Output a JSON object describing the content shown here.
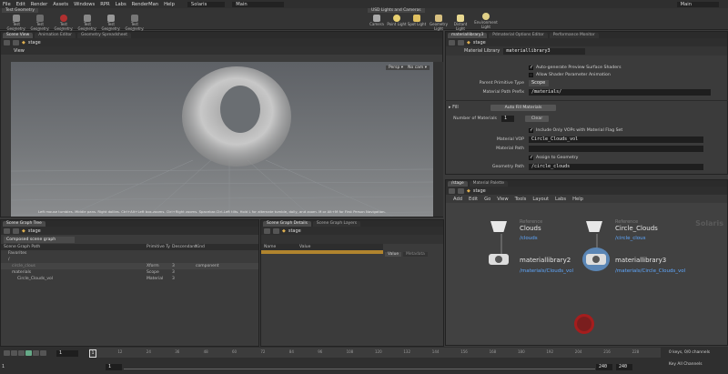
{
  "menu": {
    "items": [
      "File",
      "Edit",
      "Render",
      "Assets",
      "Windows",
      "RPR",
      "Labs",
      "RenderMan",
      "Help"
    ],
    "desktop": "Solaris",
    "context": "Main",
    "right_context": "Main"
  },
  "shelf": {
    "tabs_left": [
      "Test Geometry"
    ],
    "tabs_right": [
      "USD Lights and Cameras"
    ],
    "tools_left": [
      "Test Geometry: S...",
      "Test Geometry: T...",
      "Test Geometry: R...",
      "Test Geometry: S...",
      "Test Geometry: T...",
      "Test Geometry: T..."
    ],
    "tools_right": [
      "Camera",
      "Point Light",
      "Spot Light",
      "Geometry Light",
      "Distant Light",
      "Environment Light"
    ]
  },
  "viewport": {
    "tabs": [
      "Scene View",
      "Animation Editor",
      "Geometry Spreadsheet"
    ],
    "path": "stage",
    "view_label": "View",
    "persp": "Persp ▾",
    "camera": "No cam ▾",
    "hint": "Left mouse tumbles. Middle pans. Right dollies. Ctrl+Alt+Left box-zooms. Ctrl+Right zooms. Spacebar-Ctrl-Left tilts. Hold L for alternate tumble, dolly, and zoom.    M or Alt+M for First Person Navigation."
  },
  "params": {
    "tabs": [
      "materiallibrary3",
      "Pdmaterial Options Editor",
      "Performance Monitor"
    ],
    "path": "stage",
    "node_type": "Material Library",
    "node_name": "materiallibrary3",
    "checks": [
      "Auto-generate Preview Surface Shaders",
      "Allow Shader Parameter Animation"
    ],
    "parent_prim_type_label": "Parent Primitive Type",
    "parent_prim_type": "Scope",
    "mat_path_prefix_label": "Material Path Prefix",
    "mat_path_prefix": "/materials/",
    "fill_label": "Fill",
    "auto_fill_button": "Auto Fill Materials",
    "num_materials_label": "Number of Materials",
    "num_materials": "1",
    "clear_button": "Clear",
    "include_only": "Include Only VOPs with Material Flag Set",
    "material_vop_label": "Material VOP",
    "material_vop": "Circle_Clouds_vol",
    "material_path_label": "Material Path",
    "material_path": "",
    "assign_label": "Assign to Geometry",
    "geometry_path_label": "Geometry Path",
    "geometry_path": "/circle_clouds"
  },
  "network": {
    "tabs": [
      "/stage",
      "Material Palette"
    ],
    "path": "stage",
    "menu": [
      "Add",
      "Edit",
      "Go",
      "View",
      "Tools",
      "Layout",
      "Labs",
      "Help"
    ],
    "watermark": "Solaris",
    "nodes": [
      {
        "type": "Reference",
        "name": "Clouds",
        "path": "/clouds"
      },
      {
        "type": "Reference",
        "name": "Circle_Clouds",
        "path": "/circle_clous"
      },
      {
        "type": "",
        "name": "materiallibrary2",
        "path": "/materials/Clouds_vol"
      },
      {
        "type": "",
        "name": "materiallibrary3",
        "path": "/materials/Circle_Clouds_vol"
      }
    ]
  },
  "scenegraph": {
    "tabs": [
      "Scene Graph Tree"
    ],
    "path": "stage",
    "filter": "Composed scene graph",
    "columns": [
      "Scene Graph Path",
      "Primitive Ty",
      "Descendant",
      "Kind"
    ],
    "rows": [
      {
        "name": "Favorites",
        "type": "",
        "desc": "",
        "kind": ""
      },
      {
        "name": "/",
        "type": "",
        "desc": "",
        "kind": ""
      },
      {
        "name": "circle_clous",
        "type": "Xform",
        "desc": "3",
        "kind": "component"
      },
      {
        "name": "materials",
        "type": "Scope",
        "desc": "3",
        "kind": ""
      },
      {
        "name": "Circle_Clouds_vol",
        "type": "Material",
        "desc": "3",
        "kind": ""
      }
    ]
  },
  "details": {
    "tabs": [
      "Scene Graph Details",
      "Scene Graph Layers"
    ],
    "path": "stage",
    "columns": [
      "Name",
      "Value"
    ],
    "right_tabs": [
      "Value",
      "Metadata"
    ]
  },
  "timeline": {
    "frame": "1",
    "start": "1",
    "start2": "1",
    "end": "240",
    "end2": "240",
    "ticks": [
      "12",
      "24",
      "36",
      "48",
      "60",
      "72",
      "84",
      "96",
      "108",
      "120",
      "132",
      "144",
      "156",
      "168",
      "180",
      "192",
      "204",
      "216",
      "228"
    ],
    "keys": "0 keys, 0/0 channels",
    "keyall": "Key All Channels"
  }
}
